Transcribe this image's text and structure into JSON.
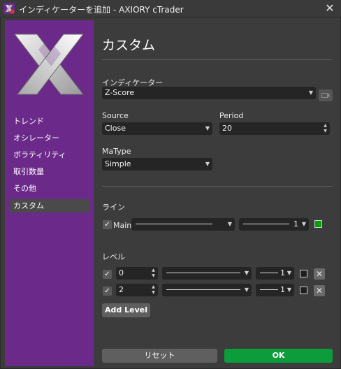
{
  "window": {
    "title": "インディケーターを追加 - AXIORY cTrader",
    "close_icon": "✕"
  },
  "sidebar": {
    "items": [
      {
        "label": "トレンド",
        "active": false
      },
      {
        "label": "オシレーター",
        "active": false
      },
      {
        "label": "ボラティリティ",
        "active": false
      },
      {
        "label": "取引数量",
        "active": false
      },
      {
        "label": "その他",
        "active": false
      },
      {
        "label": "カスタム",
        "active": true
      }
    ]
  },
  "main": {
    "heading": "カスタム",
    "indicator": {
      "label": "インディケーター",
      "value": "Z-Score"
    },
    "source": {
      "label": "Source",
      "value": "Close"
    },
    "period": {
      "label": "Period",
      "value": "20"
    },
    "matype": {
      "label": "MaType",
      "value": "Simple"
    },
    "lines": {
      "label": "ライン",
      "main": {
        "checkbox": "✓",
        "label": "Main",
        "width": "1",
        "color": "#00a000"
      }
    },
    "levels": {
      "label": "レベル",
      "rows": [
        {
          "checkbox": "✓",
          "value": "0",
          "width": "1",
          "color": "#1e1e1e"
        },
        {
          "checkbox": "✓",
          "value": "2",
          "width": "1",
          "color": "#1e1e1e"
        }
      ],
      "add_label": "Add Level"
    },
    "reset_label": "リセット",
    "ok_label": "OK"
  },
  "colors": {
    "sidebar": "#6b2a8a",
    "ok": "#0c9c3c",
    "main_line": "#00a000"
  }
}
